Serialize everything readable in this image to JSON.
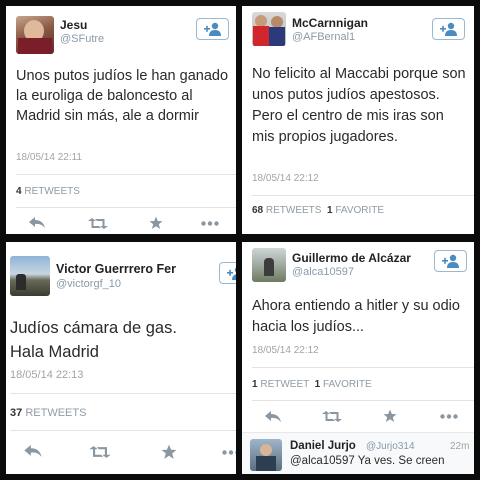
{
  "tweets": [
    {
      "name": "Jesu",
      "handle": "@SFutre",
      "text": "Unos putos judíos le han ganado la euroliga de baloncesto al Madrid sin más, ale a dormir",
      "time": "18/05/14 22:11",
      "retweets_count": "4",
      "retweets_label": "RETWEETS"
    },
    {
      "name": "McCarnnigan",
      "handle": "@AFBernal1",
      "text": "No felicito al Maccabi porque son unos putos judíos apestosos. Pero el centro de mis iras son mis propios jugadores.",
      "time": "18/05/14 22:12",
      "retweets_count": "68",
      "retweets_label": "RETWEETS",
      "favorites_count": "1",
      "favorites_label": "FAVORITE"
    },
    {
      "name": "Victor Guerrrero Fer",
      "handle": "@victorgf_10",
      "text": "Judíos cámara de gas. Hala Madrid",
      "time": "18/05/14 22:13",
      "retweets_count": "37",
      "retweets_label": "RETWEETS"
    },
    {
      "name": "Guillermo de Alcázar",
      "handle": "@alca10597",
      "text": "Ahora entiendo a hitler y su odio hacia los judíos...",
      "time": "18/05/14 22:12",
      "retweets_count": "1",
      "retweets_label": "RETWEET",
      "favorites_count": "1",
      "favorites_label": "FAVORITE"
    }
  ],
  "reply": {
    "name": "Daniel Jurjo",
    "handle": "@Jurjo314",
    "time": "22m",
    "text": "@alca10597 Ya ves. Se creen"
  },
  "icons": {
    "follow": "add-user-icon",
    "reply": "reply-arrow-icon",
    "retweet": "retweet-icon",
    "favorite": "star-icon",
    "more": "more-dots-icon"
  },
  "colors": {
    "follow_border": "#9ab8cf",
    "follow_icon": "#4a8bc2",
    "muted": "#8f9ba5",
    "action_icon": "#8a96a0"
  }
}
